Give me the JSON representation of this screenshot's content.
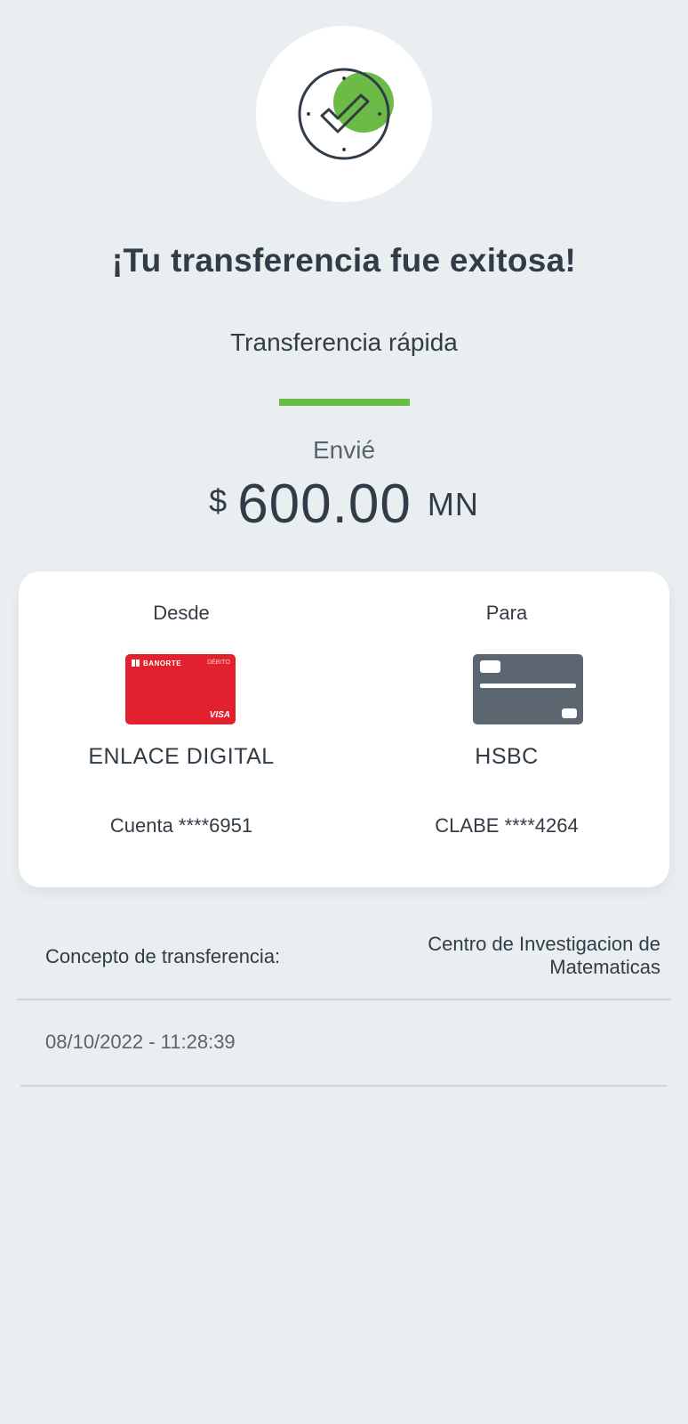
{
  "status": {
    "title": "¡Tu transferencia fue exitosa!",
    "subtitle": "Transferencia rápida",
    "sent_label": "Envié",
    "currency_symbol": "$",
    "amount": "600.00",
    "currency_unit": "MN"
  },
  "from": {
    "label": "Desde",
    "bank_name": "ENLACE DIGITAL",
    "account": "Cuenta ****6951",
    "card": {
      "brand": "BANORTE",
      "type": "DÉBITO",
      "network": "VISA",
      "color": "#e3202e"
    }
  },
  "to": {
    "label": "Para",
    "bank_name": "HSBC",
    "account": "CLABE ****4264",
    "card": {
      "color": "#5b6670"
    }
  },
  "details": {
    "concept_label": "Concepto de transferencia:",
    "concept_value_line1": "Centro de Investigacion de",
    "concept_value_line2": "Matematicas",
    "datetime": "08/10/2022 - 11:28:39"
  },
  "colors": {
    "accent": "#6cbb46",
    "background": "#e9eef1",
    "text": "#323c47"
  },
  "icons": {
    "success": "check-circle-icon"
  }
}
